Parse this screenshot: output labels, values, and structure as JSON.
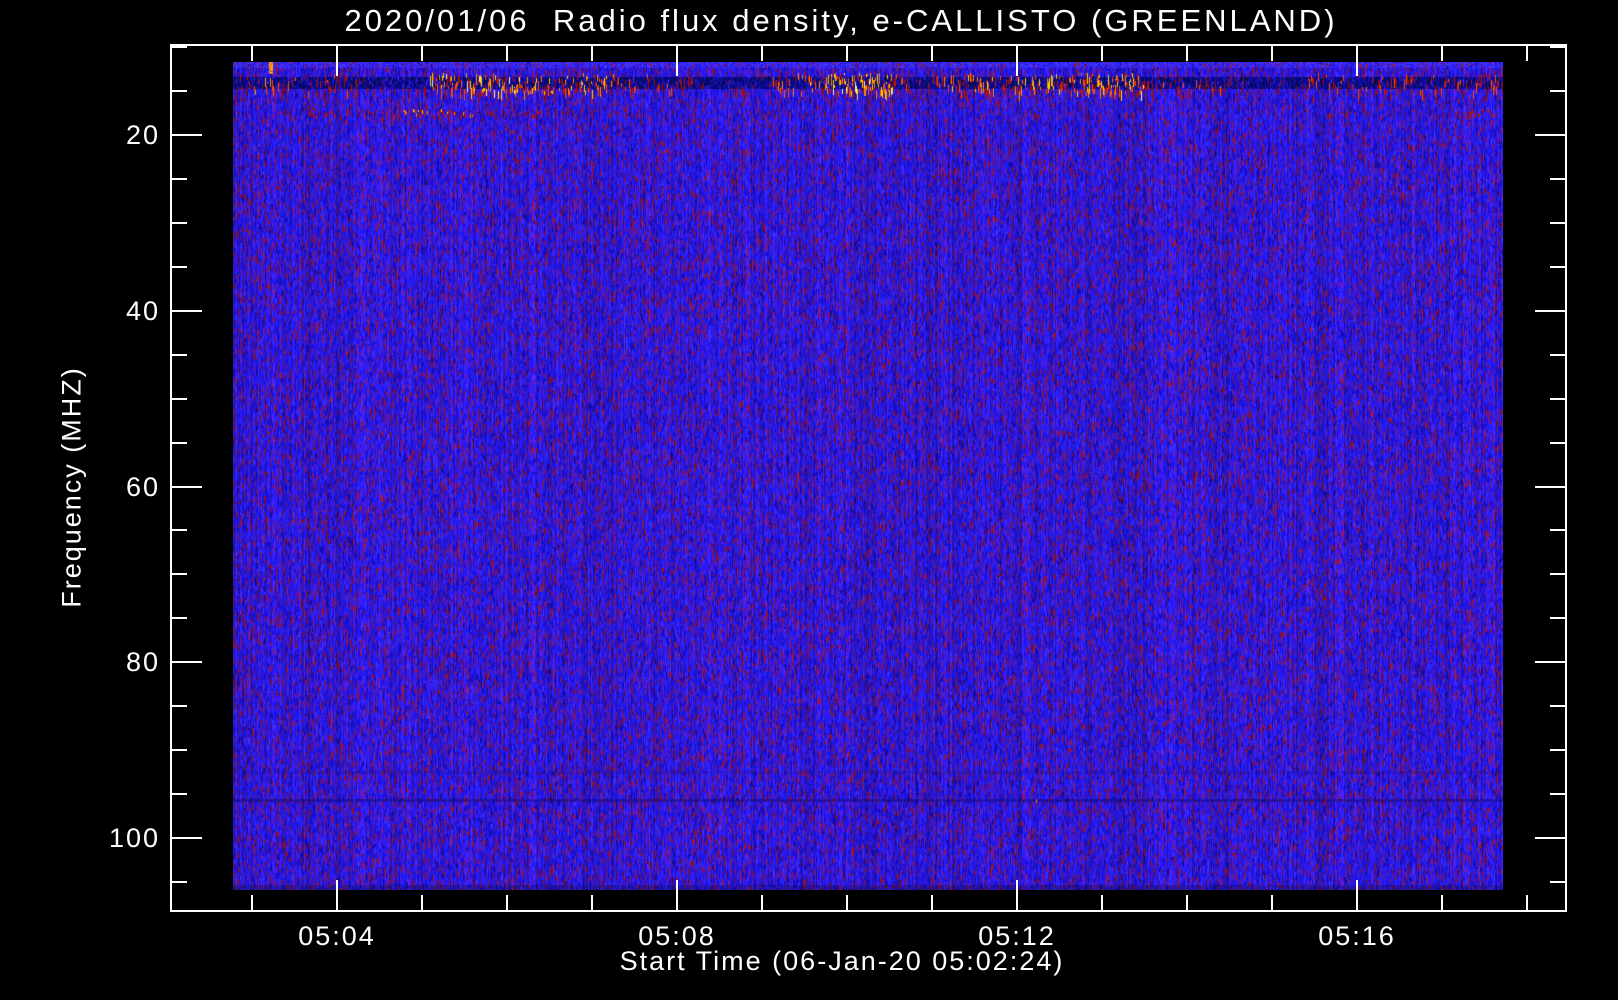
{
  "window": {
    "background": "#000000",
    "axes_color": "#ffffff",
    "text_color": "#ffffff"
  },
  "chart_data": {
    "type": "heatmap",
    "title": "2020/01/06  Radio flux density, e-CALLISTO (GREENLAND)",
    "xlabel": "Start Time (06-Jan-20 05:02:24)",
    "ylabel": "Frequency (MHZ)",
    "x_axis": {
      "tick_labels": [
        "05:04",
        "05:08",
        "05:12",
        "05:16"
      ],
      "tick_values_min": [
        4,
        8,
        12,
        16
      ],
      "minor_step_min": 1,
      "range_min": [
        2.04,
        18.45
      ],
      "start_time": "05:02:24",
      "date": "06-Jan-20"
    },
    "y_axis": {
      "tick_labels": [
        "20",
        "40",
        "60",
        "80",
        "100"
      ],
      "tick_values_mhz": [
        20,
        40,
        60,
        80,
        100
      ],
      "minor_step_mhz": 5,
      "range_mhz": [
        9.5,
        108.4
      ],
      "inverted": true
    },
    "image_extent": {
      "freq_mhz": [
        11.5,
        105.7
      ],
      "time_min": [
        2.8,
        17.7
      ]
    },
    "palette": {
      "noise": [
        {
          "c": "#2318ee",
          "w": 26
        },
        {
          "c": "#2a20ff",
          "w": 16
        },
        {
          "c": "#1b10cf",
          "w": 15
        },
        {
          "c": "#150ba8",
          "w": 8
        },
        {
          "c": "#3a2cff",
          "w": 7
        },
        {
          "c": "#4a1cd8",
          "w": 6
        },
        {
          "c": "#5b16b6",
          "w": 6
        },
        {
          "c": "#6d1287",
          "w": 5
        },
        {
          "c": "#761549",
          "w": 5
        },
        {
          "c": "#8c1130",
          "w": 4
        },
        {
          "c": "#a31322",
          "w": 2
        }
      ],
      "navy": [
        "#000566",
        "#0a0890",
        "#120c9e",
        "#02104a",
        "#1a10b0"
      ],
      "heat": [
        "#990d00",
        "#c41300",
        "#ff4d00",
        "#ff8a00",
        "#ffd400",
        "#fff2b0"
      ],
      "top_row_blues": [
        "#3a30ff",
        "#2c22f2",
        "#4a3cff"
      ]
    },
    "features": {
      "main_rfi_band": {
        "description": "strong interference band near 13-15 MHz with red/orange/yellow bursts over a dark navy lane",
        "freq_range_mhz": [
          12.8,
          15.2
        ],
        "navy_freq_range_mhz": [
          13.2,
          14.6
        ],
        "segments": [
          [
            0.0,
            0.05,
            0.55
          ],
          [
            0.05,
            0.1,
            0.4
          ],
          [
            0.1,
            0.155,
            0.1
          ],
          [
            0.155,
            0.3,
            0.95
          ],
          [
            0.3,
            0.36,
            0.45
          ],
          [
            0.36,
            0.425,
            0.2
          ],
          [
            0.425,
            0.47,
            0.75
          ],
          [
            0.47,
            0.52,
            1.0
          ],
          [
            0.52,
            0.56,
            0.5
          ],
          [
            0.56,
            0.63,
            0.8
          ],
          [
            0.63,
            0.72,
            0.9
          ],
          [
            0.72,
            0.78,
            0.4
          ],
          [
            0.78,
            0.84,
            0.12
          ],
          [
            0.84,
            1.0,
            0.5
          ]
        ]
      },
      "second_rfi_band": {
        "description": "weaker red interference line near 17 MHz, strongest around 05:05",
        "freq_range_mhz": [
          16.8,
          17.9
        ],
        "segments": [
          [
            0.06,
            0.135,
            0.35
          ],
          [
            0.135,
            0.192,
            0.95
          ],
          [
            0.192,
            0.26,
            0.3
          ],
          [
            0.26,
            0.34,
            0.1
          ],
          [
            0.962,
            0.993,
            0.5
          ]
        ]
      },
      "top_edge_spot": {
        "x_frac": 0.028,
        "description": "bright orange burst at upper image edge near 05:03"
      },
      "dark_lines": [
        {
          "freq_mhz": 92.2,
          "alpha": 0.2
        },
        {
          "freq_mhz": 95.4,
          "alpha": 0.45,
          "orange_dot_x_frac": 0.632
        }
      ]
    }
  }
}
